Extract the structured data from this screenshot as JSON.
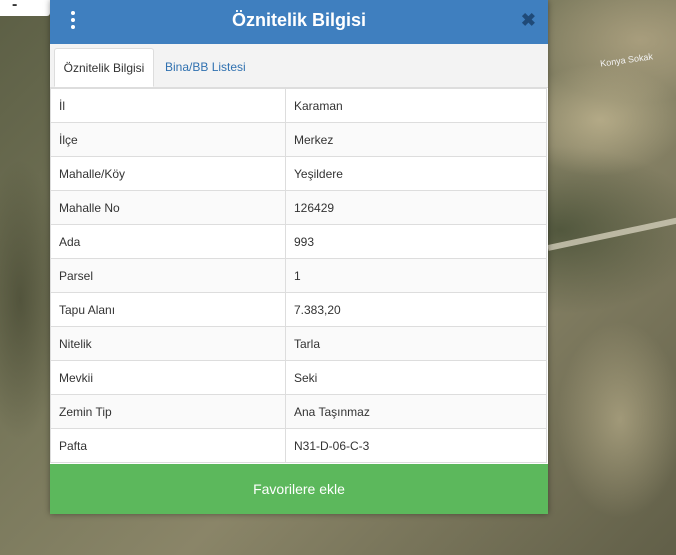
{
  "map": {
    "road_label": "Konya Sokak",
    "zoom_out_label": "-"
  },
  "panel": {
    "title": "Öznitelik Bilgisi",
    "close_label": "✖",
    "tabs": [
      {
        "label": "Öznitelik Bilgisi",
        "active": true
      },
      {
        "label": "Bina/BB Listesi",
        "active": false
      }
    ],
    "rows": [
      {
        "key": "İl",
        "value": "Karaman"
      },
      {
        "key": "İlçe",
        "value": "Merkez"
      },
      {
        "key": "Mahalle/Köy",
        "value": "Yeşildere"
      },
      {
        "key": "Mahalle No",
        "value": "126429"
      },
      {
        "key": "Ada",
        "value": "993"
      },
      {
        "key": "Parsel",
        "value": "1"
      },
      {
        "key": "Tapu Alanı",
        "value": "7.383,20"
      },
      {
        "key": "Nitelik",
        "value": "Tarla"
      },
      {
        "key": "Mevkii",
        "value": "Seki"
      },
      {
        "key": "Zemin Tip",
        "value": "Ana Taşınmaz"
      },
      {
        "key": "Pafta",
        "value": "N31-D-06-C-3"
      }
    ],
    "favorite_button": "Favorilere ekle",
    "colors": {
      "header": "#3f7fbf",
      "button": "#5cb85c",
      "link": "#3071b0"
    }
  }
}
